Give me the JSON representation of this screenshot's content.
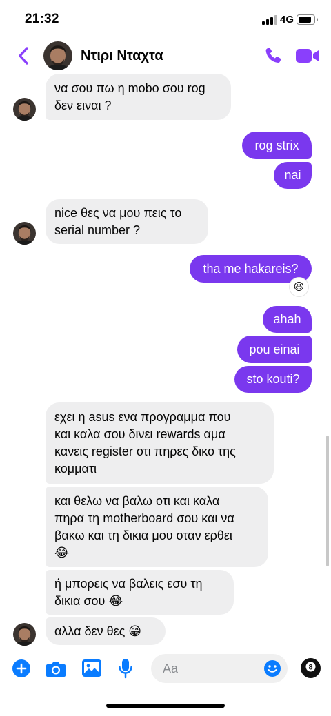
{
  "status_bar": {
    "time": "21:32",
    "network": "4G"
  },
  "header": {
    "contact_name": "Ντιρι Νταχτα"
  },
  "messages": [
    {
      "dir": "in",
      "lines": [
        "να σου πω η mobo σου rog",
        "δεν ειναι ?"
      ]
    },
    {
      "dir": "out",
      "lines": [
        "rog strix"
      ]
    },
    {
      "dir": "out",
      "lines": [
        "nai"
      ]
    },
    {
      "dir": "in",
      "lines": [
        "nice θες να μου πεις το",
        "serial number ?"
      ]
    },
    {
      "dir": "out",
      "lines": [
        "tha me hakareis?"
      ],
      "reaction": "😆"
    },
    {
      "dir": "out",
      "lines": [
        "ahah"
      ]
    },
    {
      "dir": "out",
      "lines": [
        "pou einai"
      ]
    },
    {
      "dir": "out",
      "lines": [
        "sto kouti?"
      ]
    },
    {
      "dir": "in",
      "lines": [
        "εχει η asus ενα προγραμμα που",
        "και καλα σου δινει rewards αμα",
        "κανεις register οτι πηρες δικο της",
        "κομματι"
      ]
    },
    {
      "dir": "in",
      "lines": [
        "και θελω να βαλω οτι και καλα",
        "πηρα τη motherboard σου και να",
        "βακω και τη δικια μου οταν ερθει",
        "😂"
      ]
    },
    {
      "dir": "in",
      "lines": [
        "ή μπορεις να βαλεις εσυ τη",
        "δικια σου 😂"
      ]
    },
    {
      "dir": "in",
      "lines": [
        "αλλα δεν θες 😁"
      ]
    }
  ],
  "composer": {
    "placeholder": "Aa",
    "icons": [
      "plus-icon",
      "camera-icon",
      "gallery-icon",
      "microphone-icon",
      "emoji-icon",
      "eight-ball-icon"
    ]
  },
  "colors": {
    "accent": "#7a38ee",
    "incoming_bubble": "#eeeeef",
    "icon_purple": "#8a3ffc",
    "icon_blue": "#0a7cff"
  }
}
